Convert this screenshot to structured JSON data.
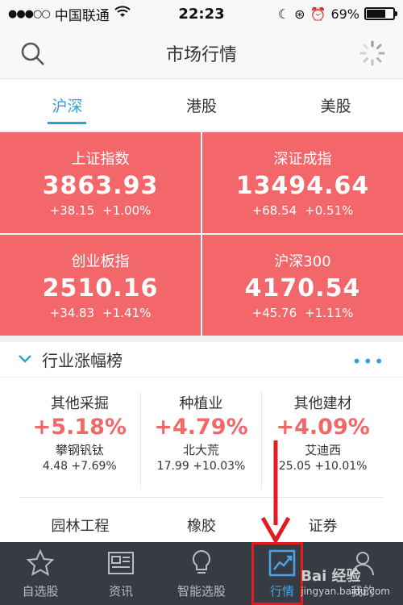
{
  "status": {
    "carrier": "中国联通",
    "time": "22:23",
    "battery": "69%"
  },
  "header": {
    "title": "市场行情"
  },
  "tabs": [
    "沪深",
    "港股",
    "美股"
  ],
  "indices": [
    {
      "name": "上证指数",
      "value": "3863.93",
      "change": "+38.15",
      "pct": "+1.00%"
    },
    {
      "name": "深证成指",
      "value": "13494.64",
      "change": "+68.54",
      "pct": "+0.51%"
    },
    {
      "name": "创业板指",
      "value": "2510.16",
      "change": "+34.83",
      "pct": "+1.41%"
    },
    {
      "name": "沪深300",
      "value": "4170.54",
      "change": "+45.76",
      "pct": "+1.11%"
    }
  ],
  "section": {
    "title": "行业涨幅榜",
    "more": "•••"
  },
  "industries": [
    {
      "name": "其他采掘",
      "pct": "+5.18%",
      "stock": "攀钢钒钛",
      "price": "4.48",
      "stock_pct": "+7.69%"
    },
    {
      "name": "种植业",
      "pct": "+4.79%",
      "stock": "北大荒",
      "price": "17.99",
      "stock_pct": "+10.03%"
    },
    {
      "name": "其他建材",
      "pct": "+4.09%",
      "stock": "艾迪西",
      "price": "25.05",
      "stock_pct": "+10.01%"
    }
  ],
  "industries_row2": [
    "园林工程",
    "橡胶",
    "证券"
  ],
  "tabbar": [
    {
      "label": "自选股",
      "icon": "star-icon"
    },
    {
      "label": "资讯",
      "icon": "news-icon"
    },
    {
      "label": "智能选股",
      "icon": "bulb-icon"
    },
    {
      "label": "行情",
      "icon": "chart-icon"
    },
    {
      "label": "我的",
      "icon": "user-icon"
    }
  ],
  "watermark": {
    "brand": "Bai 经验",
    "url": "jingyan.baidu.com"
  },
  "colors": {
    "accent": "#2aa4d8",
    "up": "#f3676b",
    "tabbar": "#373c44",
    "highlight": "#e41b23"
  }
}
